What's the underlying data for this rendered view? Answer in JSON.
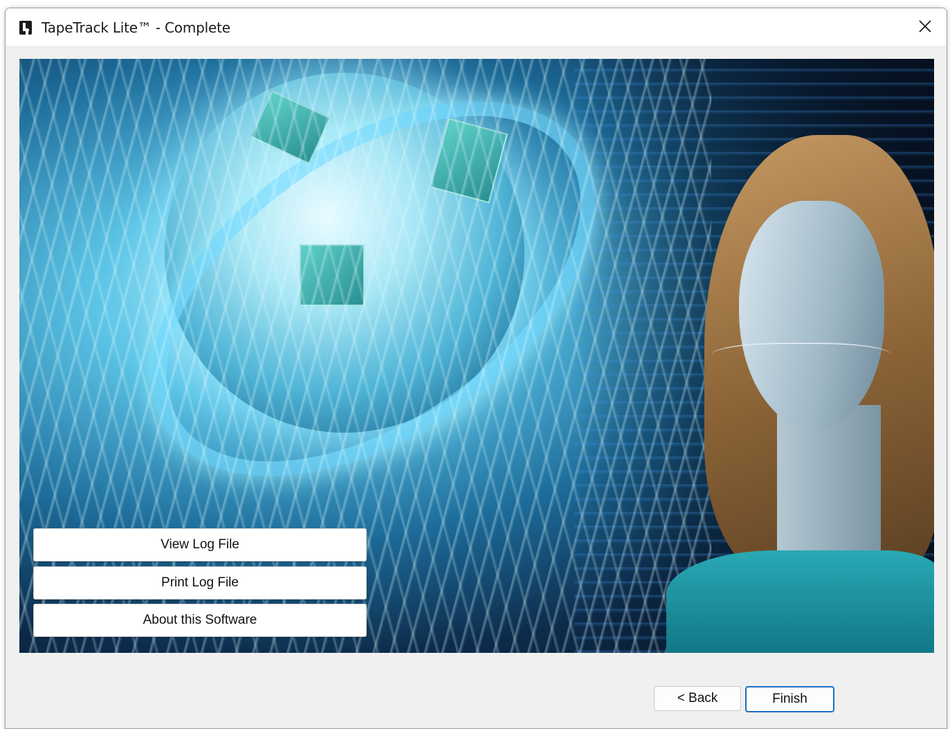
{
  "window": {
    "title": "TapeTrack Lite™ - Complete",
    "app_icon": "tapetrack-logo-icon",
    "close_icon": "close-icon"
  },
  "banner": {
    "image": "globe-and-woman-illustration"
  },
  "log_buttons": {
    "view_log": "View Log File",
    "print_log": "Print Log File",
    "about": "About this Software"
  },
  "footer": {
    "back_label": "< Back",
    "finish_label": "Finish"
  },
  "colors": {
    "accent": "#1a6fc4",
    "dialog_bg": "#f0f0f0"
  }
}
